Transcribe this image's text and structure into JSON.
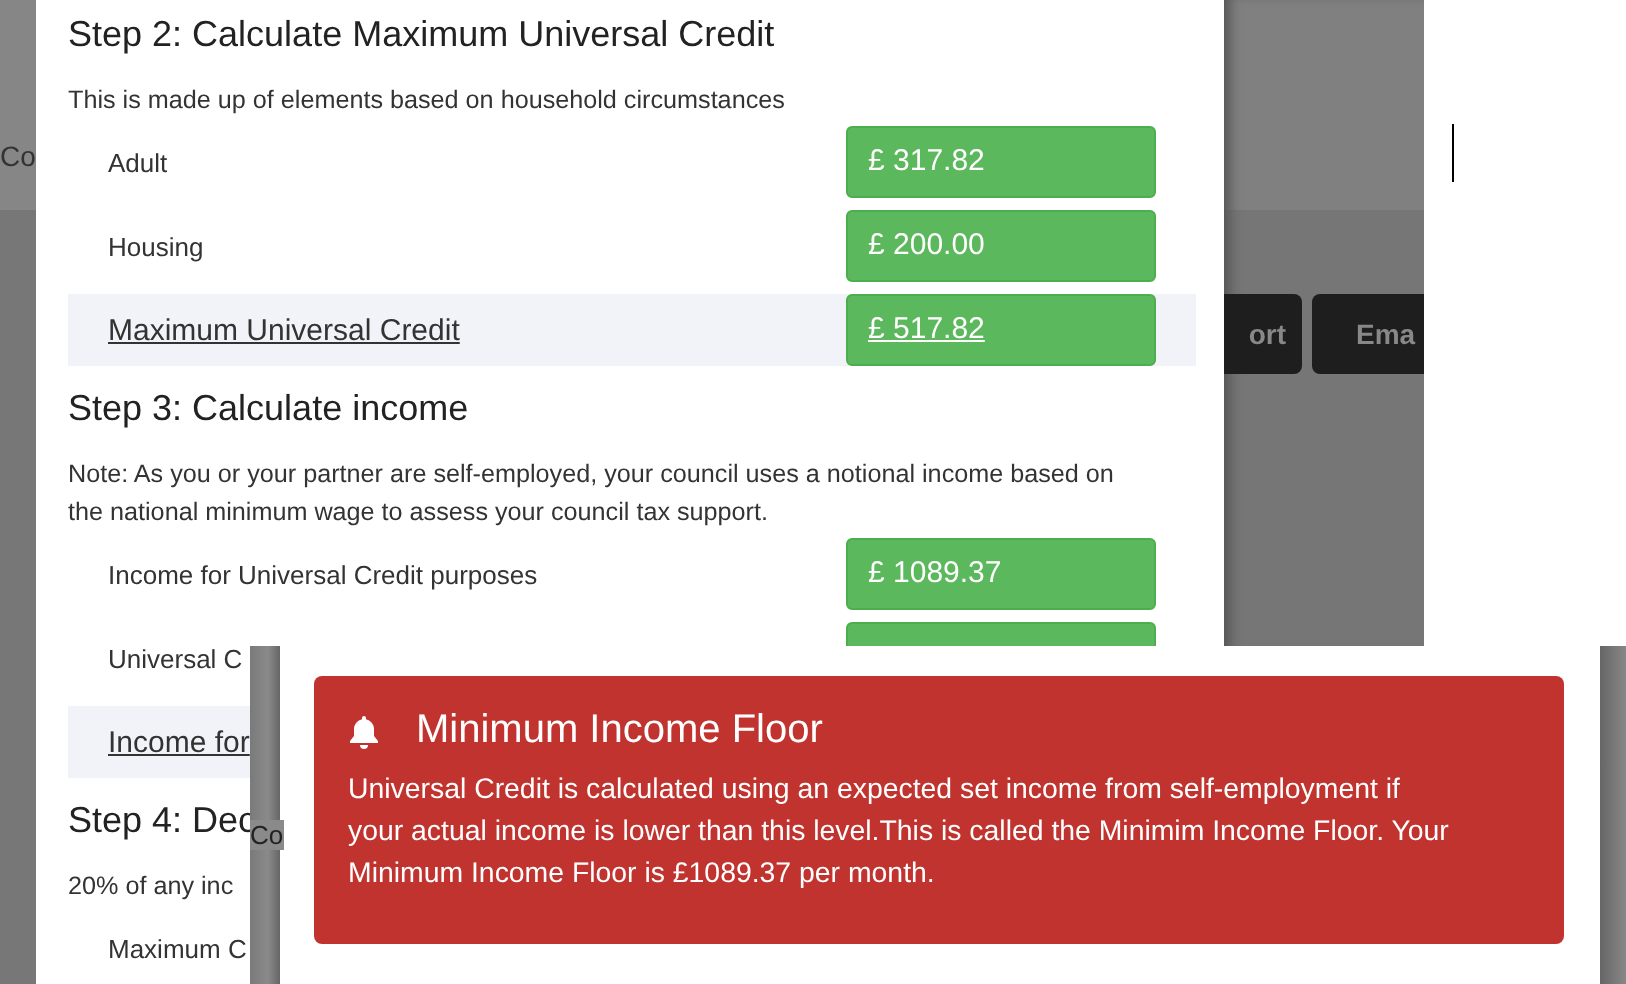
{
  "background_page": {
    "side_text": "Co",
    "buttons": [
      {
        "label": "ort"
      },
      {
        "label": "Ema"
      }
    ]
  },
  "calculation": {
    "sections": [
      {
        "heading": "Step 2: Calculate Maximum Universal Credit",
        "note": "This is made up of elements based on household circumstances",
        "rows": [
          {
            "kind": "item",
            "label": "Adult",
            "value": "£ 317.82"
          },
          {
            "kind": "item",
            "label": "Housing",
            "value": "£ 200.00"
          },
          {
            "kind": "total",
            "label": "Maximum Universal Credit",
            "value": "£ 517.82"
          }
        ]
      },
      {
        "heading": "Step 3: Calculate income",
        "note": "Note: As you or your partner are self-employed, your council uses a notional income based on the national minimum wage to assess your council tax support.",
        "rows": [
          {
            "kind": "item",
            "label": "Income for Universal Credit purposes",
            "value": "£ 1089.37"
          },
          {
            "kind": "item",
            "label": "Universal C",
            "box_shown": true
          },
          {
            "kind": "total",
            "label": "Income for"
          }
        ]
      },
      {
        "heading": "Step 4: Dec",
        "note": "20% of any inc",
        "rows": [
          {
            "kind": "item",
            "label": "Maximum C"
          }
        ]
      }
    ]
  },
  "overlay": {
    "side_text": "Co",
    "alert": {
      "title": "Minimum Income Floor",
      "message": "Universal Credit is calculated using an expected set income from self-employment if your actual income is lower than this level.This is called the Minimim Income Floor. Your Minimum Income Floor is £1089.37 per month."
    }
  }
}
